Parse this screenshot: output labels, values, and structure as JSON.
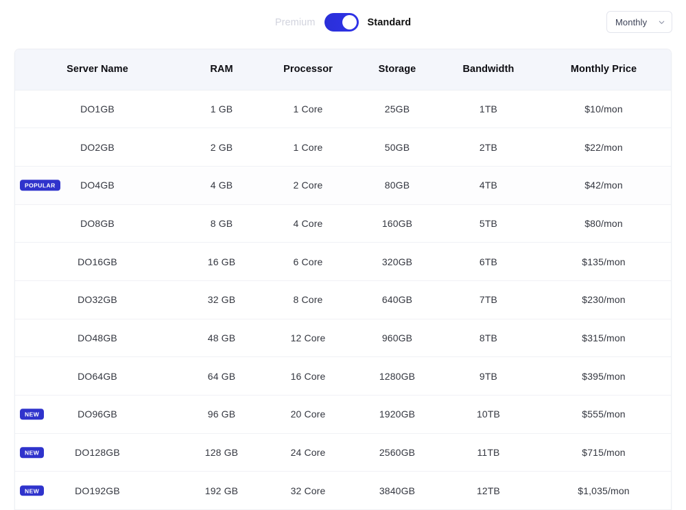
{
  "toggle": {
    "left_label": "Premium",
    "right_label": "Standard",
    "state": "right",
    "accent_color": "#2f33e0"
  },
  "period_select": {
    "value": "Monthly",
    "icon": "chevron-down-icon"
  },
  "table": {
    "columns": [
      "Server Name",
      "RAM",
      "Processor",
      "Storage",
      "Bandwidth",
      "Monthly Price"
    ],
    "badge_colors": {
      "popular": "#2f33cc",
      "new": "#2f33cc"
    },
    "rows": [
      {
        "badge": "",
        "name": "DO1GB",
        "ram": "1 GB",
        "cpu": "1 Core",
        "storage": "25GB",
        "bandwidth": "1TB",
        "price": "$10/mon"
      },
      {
        "badge": "",
        "name": "DO2GB",
        "ram": "2 GB",
        "cpu": "1 Core",
        "storage": "50GB",
        "bandwidth": "2TB",
        "price": "$22/mon"
      },
      {
        "badge": "POPULAR",
        "name": "DO4GB",
        "ram": "4 GB",
        "cpu": "2 Core",
        "storage": "80GB",
        "bandwidth": "4TB",
        "price": "$42/mon"
      },
      {
        "badge": "",
        "name": "DO8GB",
        "ram": "8 GB",
        "cpu": "4 Core",
        "storage": "160GB",
        "bandwidth": "5TB",
        "price": "$80/mon"
      },
      {
        "badge": "",
        "name": "DO16GB",
        "ram": "16 GB",
        "cpu": "6 Core",
        "storage": "320GB",
        "bandwidth": "6TB",
        "price": "$135/mon"
      },
      {
        "badge": "",
        "name": "DO32GB",
        "ram": "32 GB",
        "cpu": "8 Core",
        "storage": "640GB",
        "bandwidth": "7TB",
        "price": "$230/mon"
      },
      {
        "badge": "",
        "name": "DO48GB",
        "ram": "48 GB",
        "cpu": "12 Core",
        "storage": "960GB",
        "bandwidth": "8TB",
        "price": "$315/mon"
      },
      {
        "badge": "",
        "name": "DO64GB",
        "ram": "64 GB",
        "cpu": "16 Core",
        "storage": "1280GB",
        "bandwidth": "9TB",
        "price": "$395/mon"
      },
      {
        "badge": "NEW",
        "name": "DO96GB",
        "ram": "96 GB",
        "cpu": "20 Core",
        "storage": "1920GB",
        "bandwidth": "10TB",
        "price": "$555/mon"
      },
      {
        "badge": "NEW",
        "name": "DO128GB",
        "ram": "128 GB",
        "cpu": "24 Core",
        "storage": "2560GB",
        "bandwidth": "11TB",
        "price": "$715/mon"
      },
      {
        "badge": "NEW",
        "name": "DO192GB",
        "ram": "192 GB",
        "cpu": "32 Core",
        "storage": "3840GB",
        "bandwidth": "12TB",
        "price": "$1,035/mon"
      }
    ]
  }
}
